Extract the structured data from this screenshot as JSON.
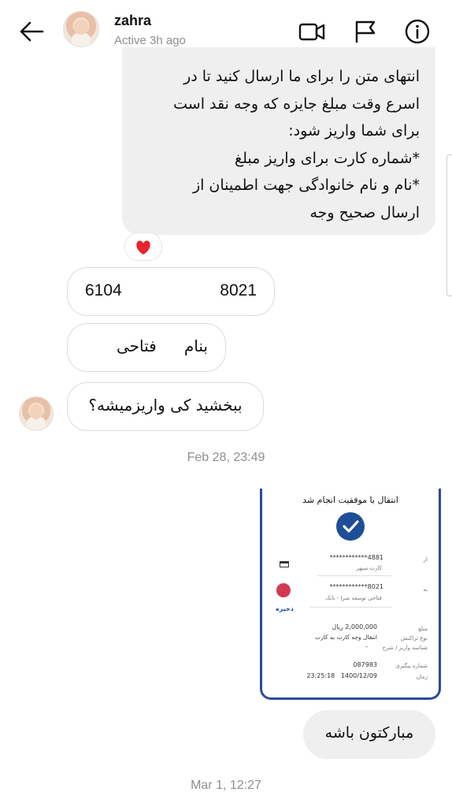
{
  "header": {
    "name": "zahra",
    "status": "Active 3h ago",
    "icons": [
      "back-arrow-icon",
      "video-call-icon",
      "flag-icon",
      "info-icon"
    ]
  },
  "messages": {
    "long_text": "انتهای متن را برای ما ارسال کنید تا در\nاسرع وقت مبلغ جایزه که وجه نقد است\nبرای شما واریز شود:\n*شماره کارت برای واریز مبلغ\n*نام و نام خانوادگی جهت اطمینان از\nارسال صحیح وجه",
    "reaction": "❤️",
    "card_left": "6104",
    "card_right": "8021",
    "name_left": "بنام",
    "name_right": "فتاحی",
    "question": "ببخشید کی واریزمیشه؟",
    "timestamp1": "Feb 28, 23:49",
    "reply": "مبارکتون باشه",
    "timestamp2": "Mar 1, 12:27"
  },
  "receipt": {
    "title": "انتقال با موفقیت انجام شد",
    "from_label": "از",
    "from_card": "************4881",
    "from_bank": "کارت سپهر",
    "to_label": "به",
    "to_card": "************8021",
    "to_name": "فتاحی توسعه صرا - بانک",
    "save_label": "ذخیره",
    "amount_label": "مبلغ",
    "amount": "2,000,000 ریال",
    "type_label": "نوع تراکنش",
    "type_value": "انتقال وجه کارت به کارت",
    "desc_label": "شناسه واریز / شرح",
    "desc_value": "-",
    "tracking_label": "شماره پیگیری",
    "tracking": "087983",
    "time_label": "زمان",
    "time": "23:25:18   1400/12/09"
  },
  "colors": {
    "bubble_gray": "#efefef",
    "receipt_blue": "#2c4a98",
    "check_blue": "#1d4e97",
    "heart": "#e8232d"
  }
}
